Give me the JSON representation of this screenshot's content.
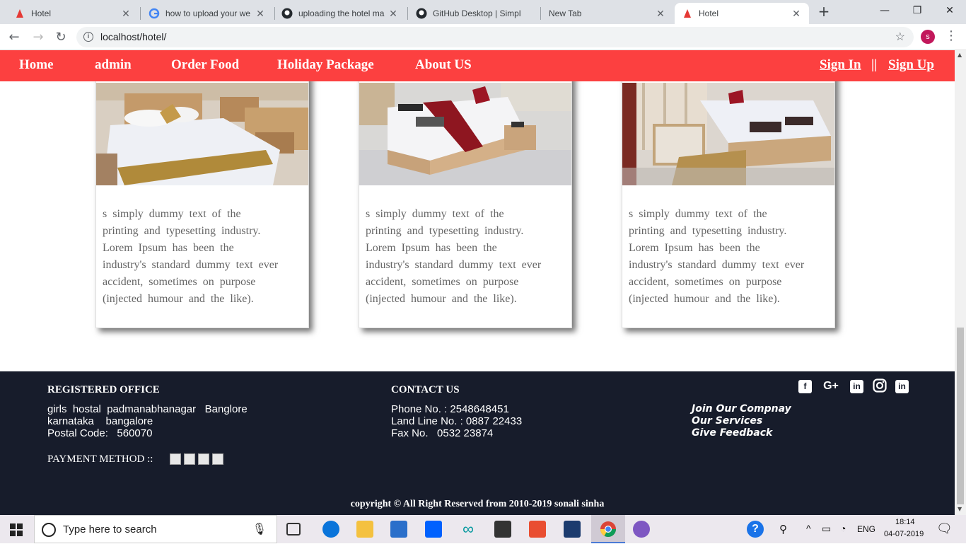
{
  "browser": {
    "tabs": [
      {
        "title": "Hotel",
        "active": false
      },
      {
        "title": "how to upload your we",
        "active": false
      },
      {
        "title": "uploading the hotel ma",
        "active": false
      },
      {
        "title": "GitHub Desktop | Simpl",
        "active": false
      },
      {
        "title": "New Tab",
        "active": false
      },
      {
        "title": "Hotel",
        "active": true
      }
    ],
    "url": "localhost/hotel/",
    "profile_initial": "s"
  },
  "nav": {
    "items": [
      "Home",
      "admin",
      "Order Food",
      "Holiday Package",
      "About US"
    ],
    "sign_in": "Sign In",
    "separator": "||",
    "sign_up": "Sign Up"
  },
  "cards": [
    {
      "lines": [
        "s simply dummy text of the",
        "printing and typesetting industry.",
        "Lorem Ipsum has been the",
        "industry's standard dummy text ever",
        "accident, sometimes on purpose",
        "(injected humour and the like)."
      ]
    },
    {
      "lines": [
        "s simply dummy text of the",
        "printing and typesetting industry.",
        "Lorem Ipsum has been the",
        "industry's standard dummy text ever",
        "accident, sometimes on purpose",
        "(injected humour and the like)."
      ]
    },
    {
      "lines": [
        "s simply dummy text of the",
        "printing and typesetting industry.",
        "Lorem Ipsum has been the",
        "industry's standard dummy text ever",
        "accident, sometimes on purpose",
        "(injected humour and the like)."
      ]
    }
  ],
  "footer": {
    "registered": {
      "heading": "REGISTERED OFFICE",
      "lines": [
        "girls  hostal  padmanabhanagar   Banglore",
        "karnataka    bangalore",
        "Postal Code:   560070"
      ]
    },
    "payment_label": "PAYMENT METHOD ::",
    "contact": {
      "heading": "CONTACT US",
      "lines": [
        "Phone No. : 2548648451",
        "Land Line No. : 0887 22433",
        "Fax No.   0532 23874"
      ]
    },
    "links": [
      "Join Our Compnay",
      "Our Services",
      "Give Feedback"
    ],
    "social": [
      "facebook-icon",
      "google-plus-icon",
      "linkedin-icon",
      "instagram-icon",
      "linkedin-icon"
    ],
    "copyright": "copyright © All Right Reserved from 2010-2019 sonali sinha"
  },
  "taskbar": {
    "search_placeholder": "Type here to search",
    "language": "ENG",
    "time": "18:14",
    "date": "04-07-2019"
  },
  "colors": {
    "nav_bg": "#fc4040",
    "footer_bg": "#171c2b"
  }
}
